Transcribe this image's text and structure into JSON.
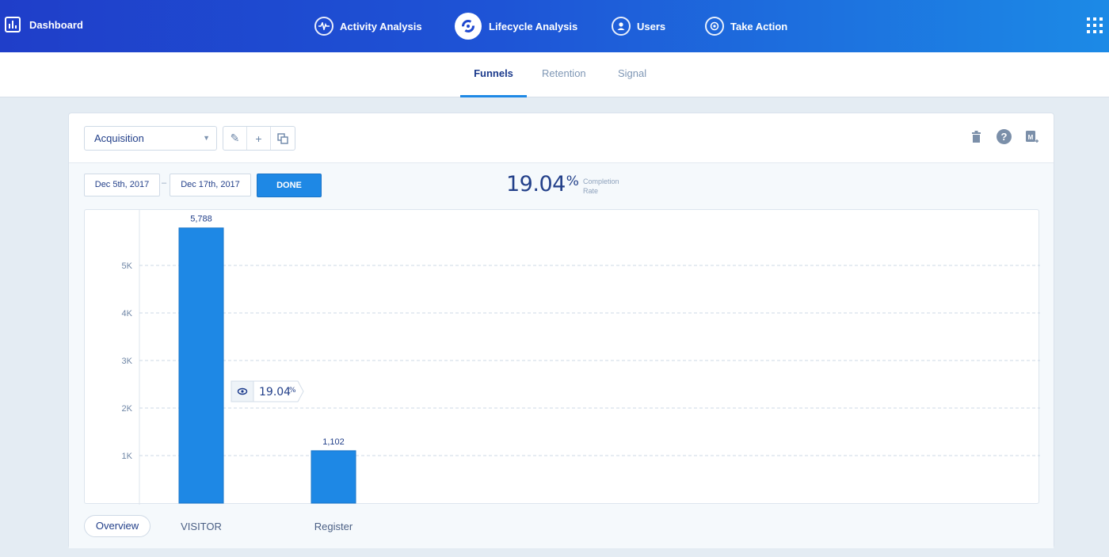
{
  "topbar": {
    "brand": "Dashboard",
    "nav": [
      {
        "label": "Activity Analysis",
        "icon": "pulse-icon"
      },
      {
        "label": "Lifecycle Analysis",
        "icon": "lifecycle-icon",
        "active": true
      },
      {
        "label": "Users",
        "icon": "user-icon"
      },
      {
        "label": "Take Action",
        "icon": "target-icon"
      }
    ],
    "apps_icon": "apps-grid-icon"
  },
  "subtabs": [
    {
      "label": "Funnels",
      "active": true
    },
    {
      "label": "Retention"
    },
    {
      "label": "Signal"
    }
  ],
  "toolbar": {
    "funnel_select": "Acquisition",
    "tools": [
      "edit-icon",
      "add-icon",
      "duplicate-icon"
    ],
    "right_tools": [
      "trash-icon",
      "help-icon",
      "export-icon"
    ]
  },
  "dates": {
    "start": "Dec 5th, 2017",
    "separator": "–",
    "end": "Dec 17th, 2017",
    "done": "DONE"
  },
  "completion": {
    "value": "19.04",
    "unit": "%",
    "label_line1": "Completion",
    "label_line2": "Rate"
  },
  "chart_data": {
    "type": "bar",
    "categories": [
      "VISITOR",
      "Register"
    ],
    "values": [
      5788,
      1102
    ],
    "value_labels": [
      "5,788",
      "1,102"
    ],
    "yticks": [
      1000,
      2000,
      3000,
      4000,
      5000
    ],
    "ytick_labels": [
      "1K",
      "2K",
      "3K",
      "4K",
      "5K"
    ],
    "conversion_badge": {
      "value": "19.04",
      "unit": "%"
    },
    "grid": "horizontal-dashed",
    "bar_color": "#1e88e5"
  },
  "footer": {
    "overview": "Overview"
  }
}
